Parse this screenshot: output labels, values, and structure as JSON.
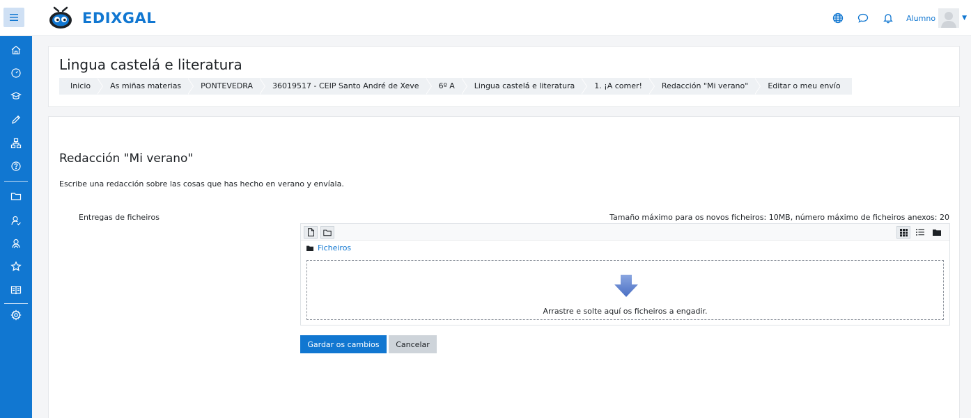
{
  "brand": {
    "name": "EDIXGAL"
  },
  "navbar": {
    "icons": [
      "language-icon",
      "messages-icon",
      "notifications-icon"
    ],
    "user_name": "Alumno"
  },
  "sidebar": {
    "items": [
      "home-icon",
      "dashboard-icon",
      "courses-icon",
      "edit-icon",
      "sitemap-icon",
      "help-icon",
      "folder-icon",
      "user-icon",
      "users-icon",
      "star-icon",
      "book-icon",
      "settings-icon"
    ]
  },
  "header": {
    "title": "Lingua castelá e literatura",
    "breadcrumb": [
      "Inicio",
      "As miñas materias",
      "PONTEVEDRA",
      "36019517 - CEIP Santo André de Xeve",
      "6º A",
      "Lingua castelá e literatura",
      "1. ¡A comer!",
      "Redacción \"Mi verano\"",
      "Editar o meu envío"
    ]
  },
  "assignment": {
    "title": "Redacción \"Mi verano\"",
    "intro": "Escribe una redacción sobre las cosas que has hecho en verano y envíala.",
    "field_label": "Entregas de ficheiros",
    "max_info": "Tamaño máximo para os novos ficheiros: 10MB, número máximo de ficheiros anexos: 20"
  },
  "filemanager": {
    "path_label": "Ficheiros",
    "drop_text": "Arrastre e solte aquí os ficheiros a engadir."
  },
  "buttons": {
    "save": "Gardar os cambios",
    "cancel": "Cancelar"
  },
  "colors": {
    "primary": "#1177d1",
    "sidebar": "#1177d1",
    "secondary_button": "#ced4da"
  }
}
